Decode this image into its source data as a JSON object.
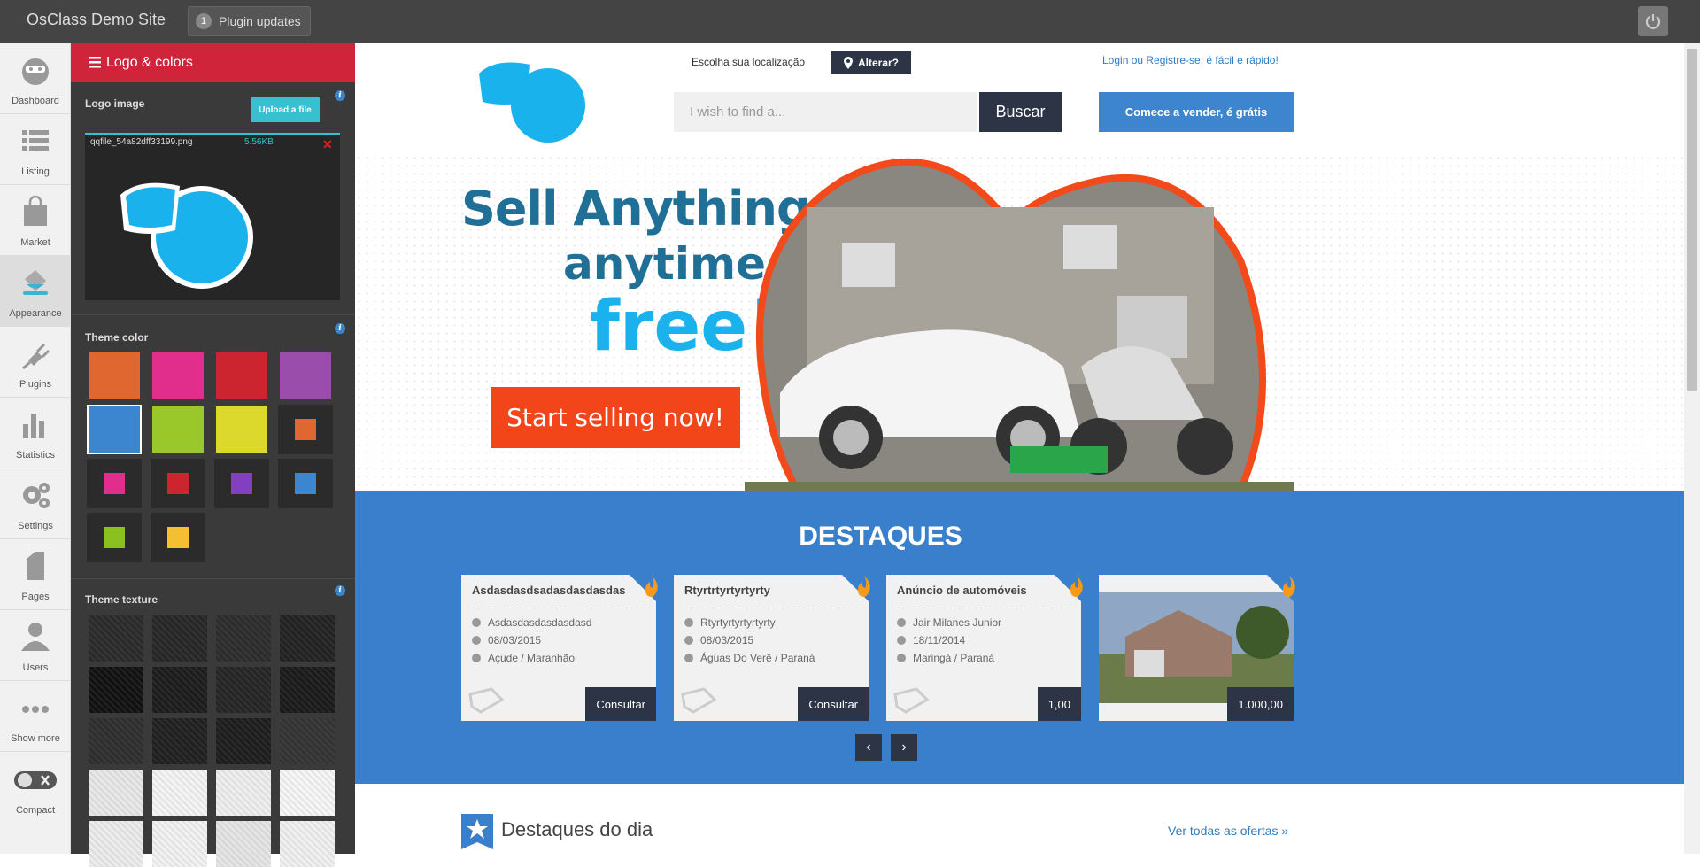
{
  "topbar": {
    "site_title": "OsClass Demo Site",
    "plugin_updates_count": "1",
    "plugin_updates_label": "Plugin updates"
  },
  "nav": {
    "items": [
      {
        "label": "Dashboard",
        "icon": "dashboard-icon"
      },
      {
        "label": "Listing",
        "icon": "listing-icon"
      },
      {
        "label": "Market",
        "icon": "market-icon"
      },
      {
        "label": "Appearance",
        "icon": "appearance-icon",
        "active": true
      },
      {
        "label": "Plugins",
        "icon": "plugins-icon"
      },
      {
        "label": "Statistics",
        "icon": "statistics-icon"
      },
      {
        "label": "Settings",
        "icon": "settings-icon"
      },
      {
        "label": "Pages",
        "icon": "pages-icon"
      },
      {
        "label": "Users",
        "icon": "users-icon"
      },
      {
        "label": "Show more",
        "icon": "more-icon"
      },
      {
        "label": "Compact",
        "icon": "compact-toggle-icon"
      }
    ]
  },
  "panel": {
    "title": "Logo & colors",
    "logo_label": "Logo image",
    "upload_label": "Upload a file",
    "file_name": "qqfile_54a82dff33199.png",
    "file_size": "5.56KB",
    "theme_color_label": "Theme color",
    "theme_texture_label": "Theme texture",
    "colors": [
      "#e06830",
      "#e12d8c",
      "#cd2530",
      "#9b4dab",
      "#3b86cf",
      "#9ac82a",
      "#dcd92c"
    ],
    "small_colors": [
      "#e06830",
      "#e12d8c",
      "#cd2530",
      "#8040c0",
      "#3b86cf",
      "#8ac020",
      "#f2c030"
    ],
    "selected_color": "#3b86cf"
  },
  "site": {
    "location_label": "Escolha sua localização",
    "location_btn": "Alterar?",
    "login_link": "Login ou Registre-se, é fácil e rápido!",
    "search_placeholder": "I wish to find a...",
    "search_btn": "Buscar",
    "sell_btn": "Comece a vender, é grátis",
    "hero": {
      "line1": "Sell Anything",
      "line2": "anytime",
      "line3": "free!",
      "cta": "Start selling now!"
    },
    "featured_title": "DESTAQUES",
    "cards": [
      {
        "title": "Asdasdasdsadasdasdasdas",
        "user": "Asdasdasdasdasdasd",
        "date": "08/03/2015",
        "location": "Açude / Maranhão",
        "price": "Consultar"
      },
      {
        "title": "Rtyrtrtyrtyrtyrty",
        "user": "Rtyrtyrtyrtyrtyrty",
        "date": "08/03/2015",
        "location": "Águas Do Verê / Paraná",
        "price": "Consultar"
      },
      {
        "title": "Anúncio de automóveis",
        "user": "Jair Milanes Junior",
        "date": "18/11/2014",
        "location": "Maringá / Paraná",
        "price": "1,00"
      },
      {
        "title": "",
        "user": "",
        "date": "",
        "location": "",
        "price": "1.000,00"
      }
    ],
    "prev": "‹",
    "next": "›",
    "daily_title": "Destaques do dia",
    "daily_link": "Ver todas as ofertas »"
  }
}
